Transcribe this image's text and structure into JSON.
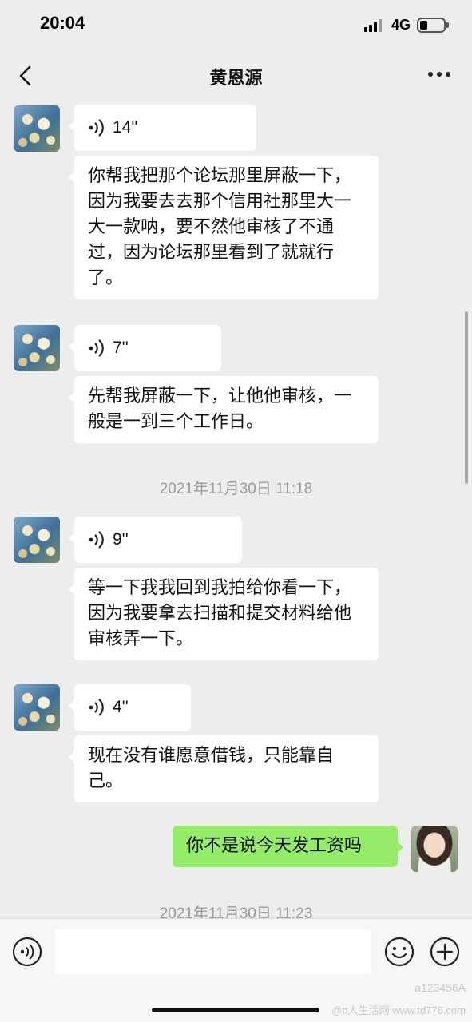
{
  "status_bar": {
    "time": "20:04",
    "network": "4G"
  },
  "header": {
    "title": "黄恩源"
  },
  "messages": {
    "m1": {
      "duration": "14''"
    },
    "m2": {
      "text": "你帮我把那个论坛那里屏蔽一下，因为我要去去那个信用社那里大一大一款呐，要不然他审核了不通过，因为论坛那里看到了就就行了。"
    },
    "m3": {
      "duration": "7''"
    },
    "m4": {
      "text": "先帮我屏蔽一下，让他他审核，一般是一到三个工作日。"
    },
    "ts1": "2021年11月30日 11:18",
    "m5": {
      "duration": "9''"
    },
    "m6": {
      "text": "等一下我我回到我拍给你看一下，因为我要拿去扫描和提交材料给他审核弄一下。"
    },
    "m7": {
      "duration": "4''"
    },
    "m8": {
      "text": "现在没有谁愿意借钱，只能靠自己。"
    },
    "m9": {
      "text": "你不是说今天发工资吗"
    },
    "ts2": "2021年11月30日 11:23"
  },
  "input_bar": {
    "placeholder": ""
  },
  "watermarks": {
    "w1": "a123456A",
    "w2": "@tt人生活网 www.td776.com"
  },
  "colors": {
    "background": "#ededed",
    "bubble_them": "#ffffff",
    "bubble_me": "#95ec69",
    "timestamp": "#9a9a9a"
  },
  "icons": {
    "back": "chevron-left-icon",
    "more": "more-dots-icon",
    "voice_wave": "voice-wave-icon",
    "voice_mode": "voice-mode-icon",
    "emoji": "emoji-icon",
    "add": "add-icon"
  }
}
